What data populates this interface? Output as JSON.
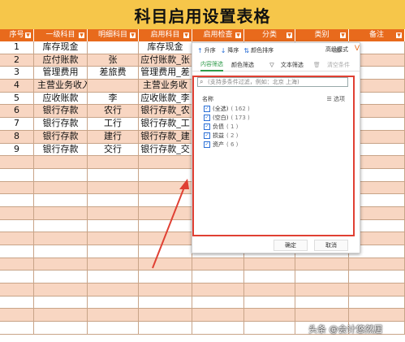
{
  "title": "科目启用设置表格",
  "headers": [
    "序号",
    "一级科目",
    "明细科目",
    "启用科目",
    "启用检查",
    "分类",
    "类别",
    "备注"
  ],
  "rows": [
    [
      "1",
      "库存现金",
      "",
      "库存现金",
      ""
    ],
    [
      "2",
      "应付账款",
      "张",
      "应付账款_张",
      ""
    ],
    [
      "3",
      "管理费用",
      "差旅费",
      "管理费用_差",
      ""
    ],
    [
      "4",
      "主营业务收入",
      "",
      "主营业务收",
      ""
    ],
    [
      "5",
      "应收账款",
      "李",
      "应收账款_李",
      ""
    ],
    [
      "6",
      "银行存款",
      "农行",
      "银行存款_农",
      ""
    ],
    [
      "7",
      "银行存款",
      "工行",
      "银行存款_工",
      ""
    ],
    [
      "8",
      "银行存款",
      "建行",
      "银行存款_建",
      ""
    ],
    [
      "9",
      "银行存款",
      "交行",
      "银行存款_交",
      ""
    ]
  ],
  "filter_panel": {
    "sort_asc": "升序",
    "sort_desc": "降序",
    "color_sort": "颜色排序",
    "advanced_mode": "高级模式",
    "tab_content": "内容筛选",
    "tab_color": "颜色筛选",
    "text_filter": "文本筛选",
    "clear_filter": "清空条件",
    "search_placeholder": "(支持多条件过滤，例如：北京 上海)",
    "list_name": "名称",
    "list_options": "选项",
    "items": [
      {
        "label": "(全选)",
        "count": "( 162 )"
      },
      {
        "label": "(空白)",
        "count": "( 173 )"
      },
      {
        "label": "负债",
        "count": "( 1 )"
      },
      {
        "label": "损益",
        "count": "( 2 )"
      },
      {
        "label": "资产",
        "count": "( 6 )"
      }
    ],
    "ok": "确定",
    "cancel": "取消"
  },
  "watermark": "头条 @会计悠然居",
  "colors": {
    "title_bg": "#f6c64a",
    "header_bg": "#e86a1c",
    "alt_row": "#f8d6c2",
    "red_box": "#e04033"
  }
}
